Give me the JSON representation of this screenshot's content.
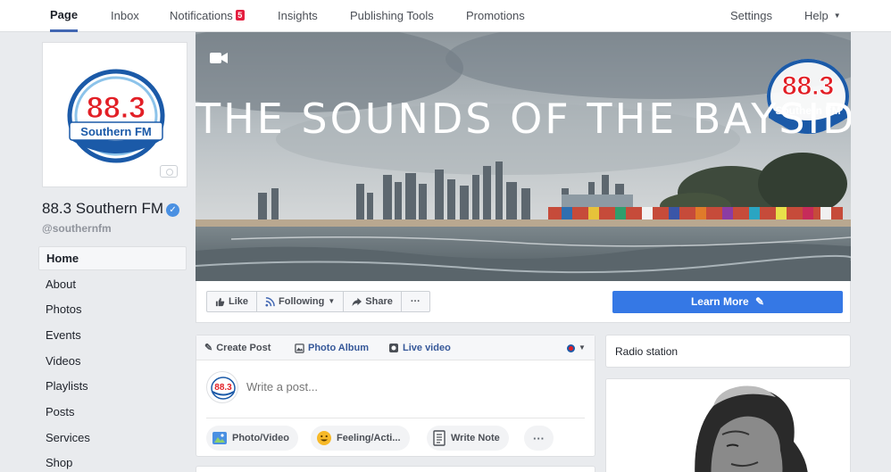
{
  "topnav": {
    "page": "Page",
    "inbox": "Inbox",
    "notifications": "Notifications",
    "notifications_count": "5",
    "insights": "Insights",
    "publishing_tools": "Publishing Tools",
    "promotions": "Promotions",
    "settings": "Settings",
    "help": "Help"
  },
  "page": {
    "name": "88.3 Southern FM",
    "handle": "@southernfm",
    "logo_number": "88.3",
    "logo_text": "Southern FM"
  },
  "leftnav": {
    "items": [
      "Home",
      "About",
      "Photos",
      "Events",
      "Videos",
      "Playlists",
      "Posts",
      "Services",
      "Shop"
    ]
  },
  "cover": {
    "title": "THE SOUNDS OF THE BAYSIDE"
  },
  "actions": {
    "like": "Like",
    "following": "Following",
    "share": "Share",
    "more": "···",
    "learn_more": "Learn More"
  },
  "composer": {
    "create_post": "Create Post",
    "photo_album": "Photo Album",
    "live_video": "Live video",
    "placeholder": "Write a post...",
    "photo_video": "Photo/Video",
    "feeling": "Feeling/Acti...",
    "write_note": "Write Note",
    "more": "···"
  },
  "about": {
    "category": "Radio station"
  },
  "colors": {
    "accent": "#4267b2",
    "link": "#365899",
    "learn_more_bg": "#3578e5",
    "logo_red": "#e21f26",
    "logo_blue": "#1b5aa8"
  }
}
